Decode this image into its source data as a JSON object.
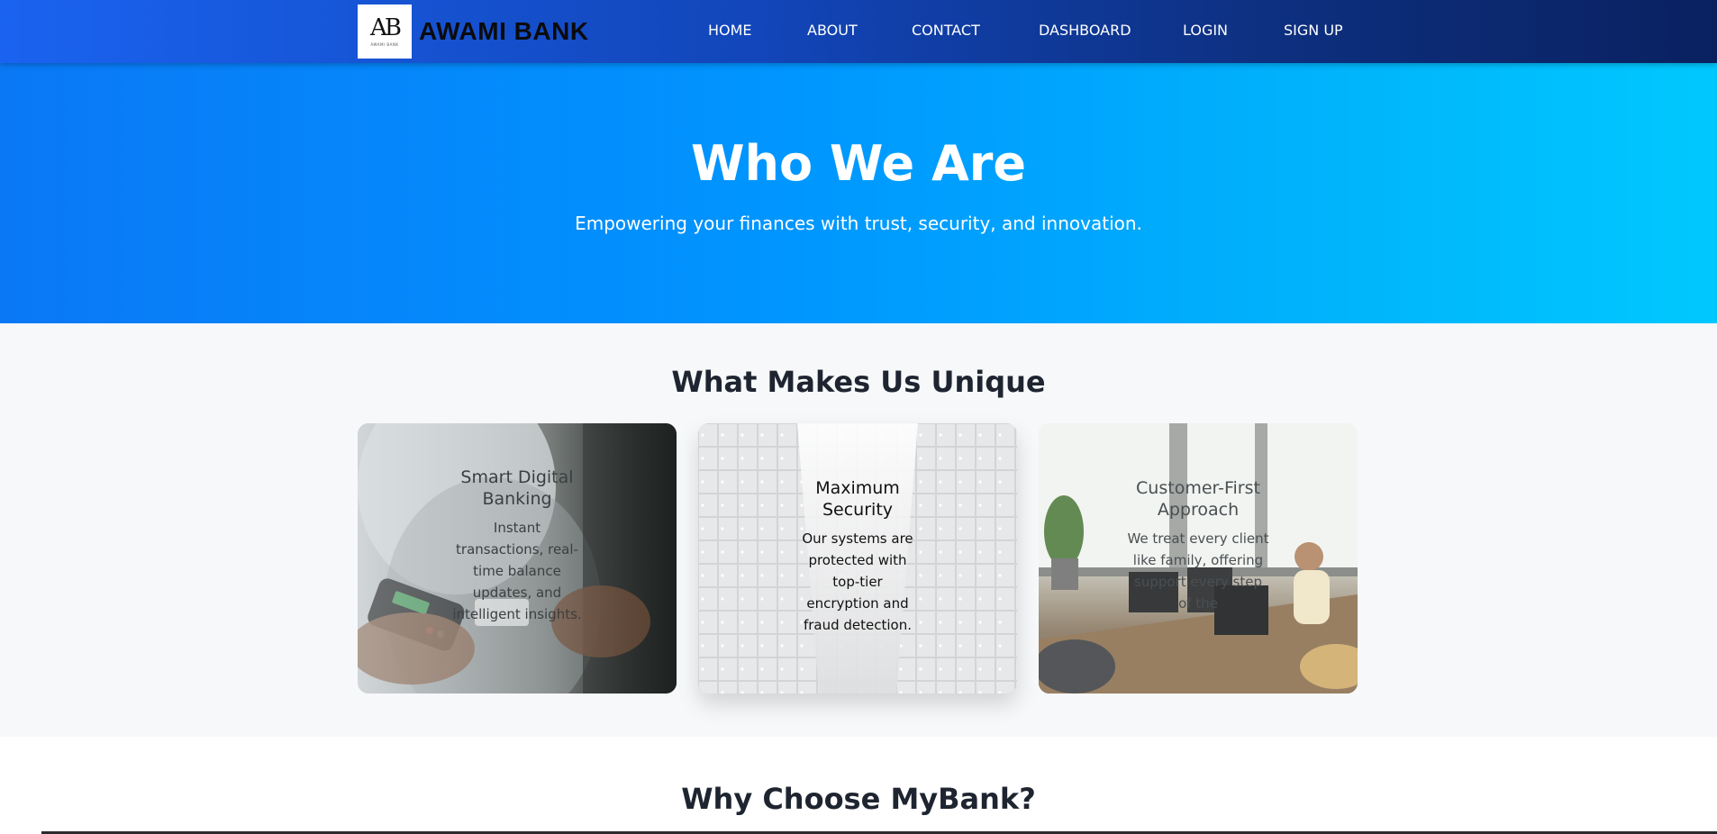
{
  "nav": {
    "brand": {
      "logo_mark": "AB",
      "logo_sub": "AWAMI BANK",
      "name": "AWAMI BANK"
    },
    "links": [
      {
        "label": "HOME"
      },
      {
        "label": "ABOUT"
      },
      {
        "label": "CONTACT"
      },
      {
        "label": "DASHBOARD"
      },
      {
        "label": "LOGIN"
      },
      {
        "label": "SIGN UP"
      }
    ]
  },
  "hero": {
    "title": "Who We Are",
    "subtitle": "Empowering your finances with trust, security, and innovation."
  },
  "unique": {
    "title": "What Makes Us Unique",
    "cards": [
      {
        "title": "Smart Digital Banking",
        "description": "Instant transactions, real-time balance updates, and intelligent insights.",
        "image": "payment-terminal-photo"
      },
      {
        "title": "Maximum Security",
        "description": "Our systems are protected with top-tier encryption and fraud detection.",
        "image": "safe-deposit-lockers-photo"
      },
      {
        "title": "Customer-First Approach",
        "description": "We treat every client like family, offering support every step of the",
        "image": "office-support-agent-photo"
      }
    ]
  },
  "why": {
    "title": "Why Choose MyBank?"
  },
  "colors": {
    "nav_gradient_start": "#1a63f0",
    "nav_gradient_end": "#0a2160",
    "hero_gradient_start": "#0a78f5",
    "hero_gradient_end": "#00c8ff",
    "section_bg": "#f6f8fa",
    "heading_text": "#1e2530"
  }
}
